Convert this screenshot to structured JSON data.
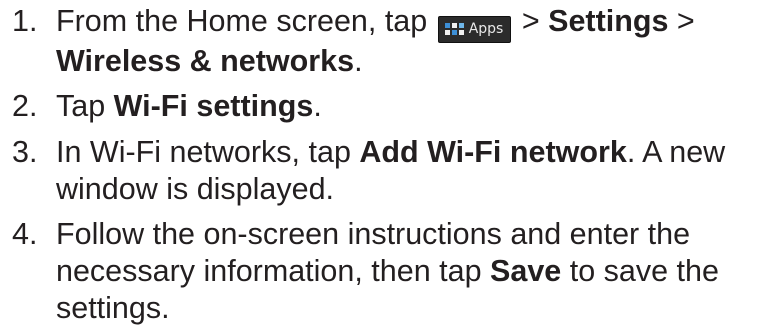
{
  "steps": [
    {
      "number": "1.",
      "parts": {
        "a": "From the Home screen, tap ",
        "icon_label": "Apps",
        "b": " > ",
        "c": "Settings",
        "d": " > ",
        "e": "Wireless & networks",
        "f": "."
      }
    },
    {
      "number": "2.",
      "parts": {
        "a": "Tap ",
        "b": "Wi-Fi settings",
        "c": "."
      }
    },
    {
      "number": "3.",
      "parts": {
        "a": "In Wi-Fi networks, tap ",
        "b": "Add Wi-Fi network",
        "c": ". A new window is displayed."
      }
    },
    {
      "number": "4.",
      "parts": {
        "a": "Follow the on-screen instructions and enter the necessary information, then tap ",
        "b": "Save",
        "c": " to save the settings."
      }
    }
  ],
  "apps_icon": {
    "name": "apps-grid-icon",
    "background": "#2b2b2b",
    "tile_colors": [
      "#3d8fd6",
      "#f0f0f0",
      "#6fb7ea",
      "#f0f0f0",
      "#3d8fd6",
      "#f0f0f0"
    ]
  },
  "colors": {
    "text": "#231f20",
    "background": "#ffffff"
  }
}
